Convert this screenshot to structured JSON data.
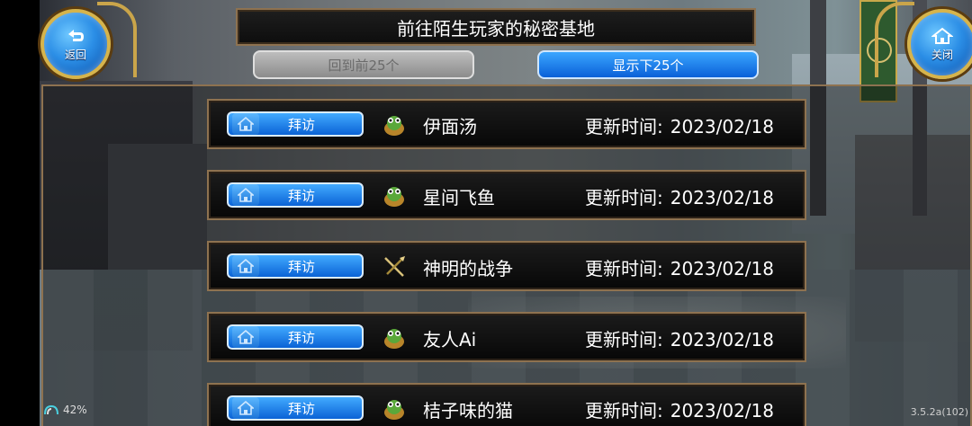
{
  "header": {
    "title": "前往陌生玩家的秘密基地",
    "back_label": "返回",
    "close_label": "关闭"
  },
  "nav": {
    "prev_label": "回到前25个",
    "next_label": "显示下25个"
  },
  "entries": [
    {
      "visit_label": "拜访",
      "avatar": "frog-pot-icon",
      "name": "伊面汤",
      "update_label": "更新时间:",
      "date": "2023/02/18"
    },
    {
      "visit_label": "拜访",
      "avatar": "frog-pot-icon",
      "name": "星间飞鱼",
      "update_label": "更新时间:",
      "date": "2023/02/18"
    },
    {
      "visit_label": "拜访",
      "avatar": "sword-axe-icon",
      "name": "神明的战争",
      "update_label": "更新时间:",
      "date": "2023/02/18"
    },
    {
      "visit_label": "拜访",
      "avatar": "frog-pot-icon",
      "name": "友人Ai",
      "update_label": "更新时间:",
      "date": "2023/02/18"
    },
    {
      "visit_label": "拜访",
      "avatar": "frog-pot-icon",
      "name": "桔子味的猫",
      "update_label": "更新时间:",
      "date": "2023/02/18"
    }
  ],
  "status": {
    "battery": "42%",
    "version": "3.5.2a(102)"
  },
  "colors": {
    "accent_blue": "#0a60d8",
    "frame_gold": "#8e7250",
    "disabled_gray": "#9a9a9a"
  }
}
